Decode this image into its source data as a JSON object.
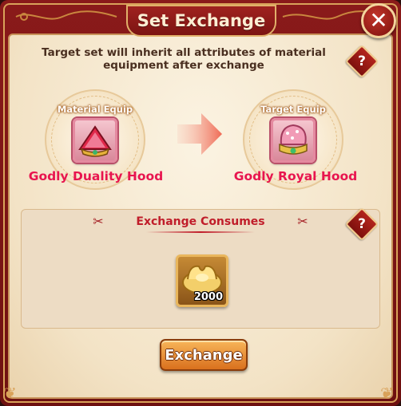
{
  "dialog": {
    "title": "Set Exchange",
    "description": "Target set will inherit all attributes of material equipment after exchange"
  },
  "material": {
    "label": "Material Equip",
    "item_name": "Godly Duality Hood",
    "icon": "duality-hood-icon"
  },
  "target": {
    "label": "Target Equip",
    "item_name": "Godly Royal Hood",
    "icon": "royal-hood-icon"
  },
  "consume": {
    "title": "Exchange Consumes",
    "cost_amount": "2000",
    "icon": "gold-ingot-icon"
  },
  "buttons": {
    "exchange_label": "Exchange",
    "close_glyph": "✕",
    "help_glyph": "?"
  },
  "colors": {
    "frame": "#8a1a1a",
    "item_name": "#e8154f",
    "consume_title": "#c01d2a",
    "button": "#e8902f"
  }
}
